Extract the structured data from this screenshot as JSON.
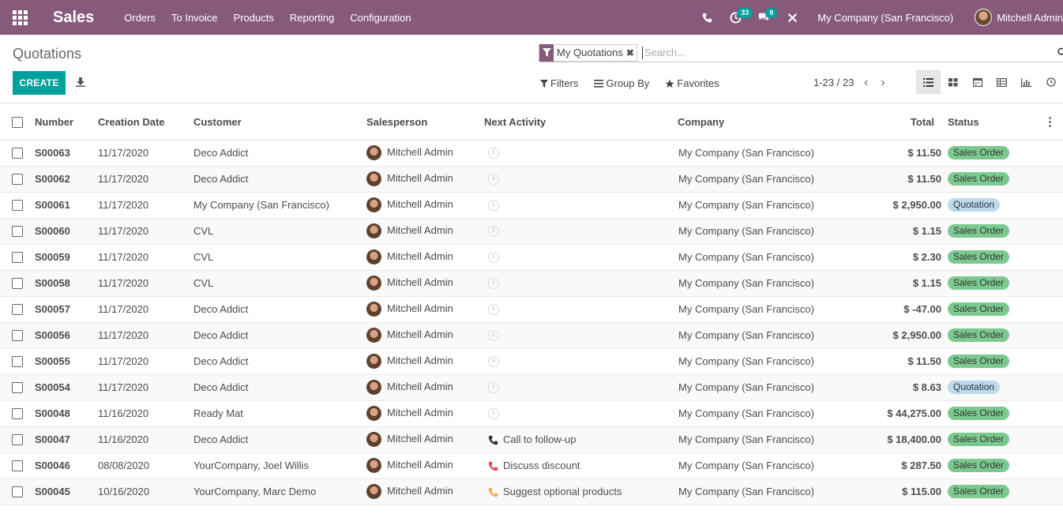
{
  "navbar": {
    "brand": "Sales",
    "menu": [
      "Orders",
      "To Invoice",
      "Products",
      "Reporting",
      "Configuration"
    ],
    "activity_count": "33",
    "message_count": "9",
    "company": "My Company (San Francisco)",
    "user": "Mitchell Admin",
    "color": "#875a7b"
  },
  "control": {
    "breadcrumb": "Quotations",
    "facet_label": "My Quotations",
    "facet_remove": "✖",
    "search_placeholder": "Search...",
    "create_label": "CREATE",
    "filters_label": "Filters",
    "groupby_label": "Group By",
    "favorites_label": "Favorites",
    "pager": "1-23 / 23",
    "prev": "‹",
    "next": "›",
    "accent": "#00a09d"
  },
  "table": {
    "headers": {
      "number": "Number",
      "date": "Creation Date",
      "customer": "Customer",
      "salesperson": "Salesperson",
      "activity": "Next Activity",
      "company": "Company",
      "total": "Total",
      "status": "Status",
      "options": "⋮"
    },
    "rows": [
      {
        "number": "S00063",
        "date": "11/17/2020",
        "customer": "Deco Addict",
        "salesperson": "Mitchell Admin",
        "activity": "",
        "activity_type": "none",
        "company": "My Company (San Francisco)",
        "total": "$ 11.50",
        "status": "Sales Order",
        "status_type": "so"
      },
      {
        "number": "S00062",
        "date": "11/17/2020",
        "customer": "Deco Addict",
        "salesperson": "Mitchell Admin",
        "activity": "",
        "activity_type": "none",
        "company": "My Company (San Francisco)",
        "total": "$ 11.50",
        "status": "Sales Order",
        "status_type": "so"
      },
      {
        "number": "S00061",
        "date": "11/17/2020",
        "customer": "My Company (San Francisco)",
        "salesperson": "Mitchell Admin",
        "activity": "",
        "activity_type": "none",
        "company": "My Company (San Francisco)",
        "total": "$ 2,950.00",
        "status": "Quotation",
        "status_type": "qt"
      },
      {
        "number": "S00060",
        "date": "11/17/2020",
        "customer": "CVL",
        "salesperson": "Mitchell Admin",
        "activity": "",
        "activity_type": "none",
        "company": "My Company (San Francisco)",
        "total": "$ 1.15",
        "status": "Sales Order",
        "status_type": "so"
      },
      {
        "number": "S00059",
        "date": "11/17/2020",
        "customer": "CVL",
        "salesperson": "Mitchell Admin",
        "activity": "",
        "activity_type": "none",
        "company": "My Company (San Francisco)",
        "total": "$ 2.30",
        "status": "Sales Order",
        "status_type": "so"
      },
      {
        "number": "S00058",
        "date": "11/17/2020",
        "customer": "CVL",
        "salesperson": "Mitchell Admin",
        "activity": "",
        "activity_type": "none",
        "company": "My Company (San Francisco)",
        "total": "$ 1.15",
        "status": "Sales Order",
        "status_type": "so"
      },
      {
        "number": "S00057",
        "date": "11/17/2020",
        "customer": "Deco Addict",
        "salesperson": "Mitchell Admin",
        "activity": "",
        "activity_type": "none",
        "company": "My Company (San Francisco)",
        "total": "$ -47.00",
        "status": "Sales Order",
        "status_type": "so"
      },
      {
        "number": "S00056",
        "date": "11/17/2020",
        "customer": "Deco Addict",
        "salesperson": "Mitchell Admin",
        "activity": "",
        "activity_type": "none",
        "company": "My Company (San Francisco)",
        "total": "$ 2,950.00",
        "status": "Sales Order",
        "status_type": "so"
      },
      {
        "number": "S00055",
        "date": "11/17/2020",
        "customer": "Deco Addict",
        "salesperson": "Mitchell Admin",
        "activity": "",
        "activity_type": "none",
        "company": "My Company (San Francisco)",
        "total": "$ 11.50",
        "status": "Sales Order",
        "status_type": "so"
      },
      {
        "number": "S00054",
        "date": "11/17/2020",
        "customer": "Deco Addict",
        "salesperson": "Mitchell Admin",
        "activity": "",
        "activity_type": "none",
        "company": "My Company (San Francisco)",
        "total": "$ 8.63",
        "status": "Quotation",
        "status_type": "qt"
      },
      {
        "number": "S00048",
        "date": "11/16/2020",
        "customer": "Ready Mat",
        "salesperson": "Mitchell Admin",
        "activity": "",
        "activity_type": "none",
        "company": "My Company (San Francisco)",
        "total": "$ 44,275.00",
        "status": "Sales Order",
        "status_type": "so"
      },
      {
        "number": "S00047",
        "date": "11/16/2020",
        "customer": "Deco Addict",
        "salesperson": "Mitchell Admin",
        "activity": "Call to follow-up",
        "activity_type": "planned",
        "company": "My Company (San Francisco)",
        "total": "$ 18,400.00",
        "status": "Sales Order",
        "status_type": "so"
      },
      {
        "number": "S00046",
        "date": "08/08/2020",
        "customer": "YourCompany, Joel Willis",
        "salesperson": "Mitchell Admin",
        "activity": "Discuss discount",
        "activity_type": "overdue",
        "company": "My Company (San Francisco)",
        "total": "$ 287.50",
        "status": "Sales Order",
        "status_type": "so"
      },
      {
        "number": "S00045",
        "date": "10/16/2020",
        "customer": "YourCompany, Marc Demo",
        "salesperson": "Mitchell Admin",
        "activity": "Suggest optional products",
        "activity_type": "today",
        "company": "My Company (San Francisco)",
        "total": "$ 115.00",
        "status": "Sales Order",
        "status_type": "so"
      }
    ],
    "activity_colors": {
      "planned": "#333333",
      "overdue": "#d9534f",
      "today": "#f0ad4e"
    }
  }
}
